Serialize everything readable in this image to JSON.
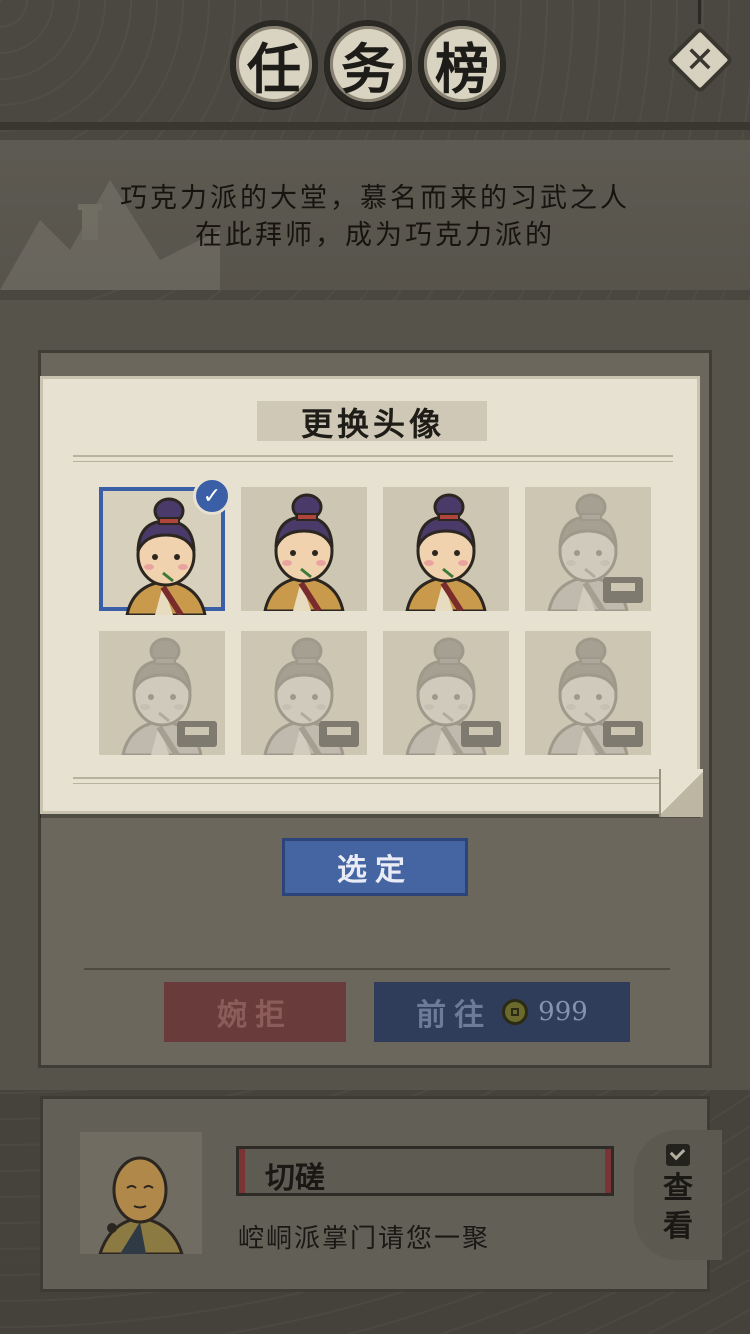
{
  "header": {
    "title_chars": [
      "任",
      "务",
      "榜"
    ],
    "close_icon": "close-icon"
  },
  "quest": {
    "description_line1": "巧克力派的大堂，慕名而来的习武之人",
    "description_line2": "在此拜师，成为巧克力派的",
    "reject_label": "婉拒",
    "go_label": "前往",
    "go_cost": "999",
    "cost_icon": "copper-coin-icon"
  },
  "avatar_popup": {
    "title": "更换头像",
    "select_label": "选定",
    "avatars": [
      {
        "state": "selected"
      },
      {
        "state": "unlocked"
      },
      {
        "state": "unlocked"
      },
      {
        "state": "locked"
      },
      {
        "state": "locked"
      },
      {
        "state": "locked"
      },
      {
        "state": "locked"
      },
      {
        "state": "locked"
      }
    ],
    "selected_color": "#3a5fa6"
  },
  "npc": {
    "name": "切磋",
    "description": "崆峒派掌门请您一聚",
    "view_label": "查看",
    "view_icon": "mail-icon"
  },
  "colors": {
    "reject": "#6a3b3b",
    "go": "#2f3c5a",
    "select": "#4564a2"
  }
}
